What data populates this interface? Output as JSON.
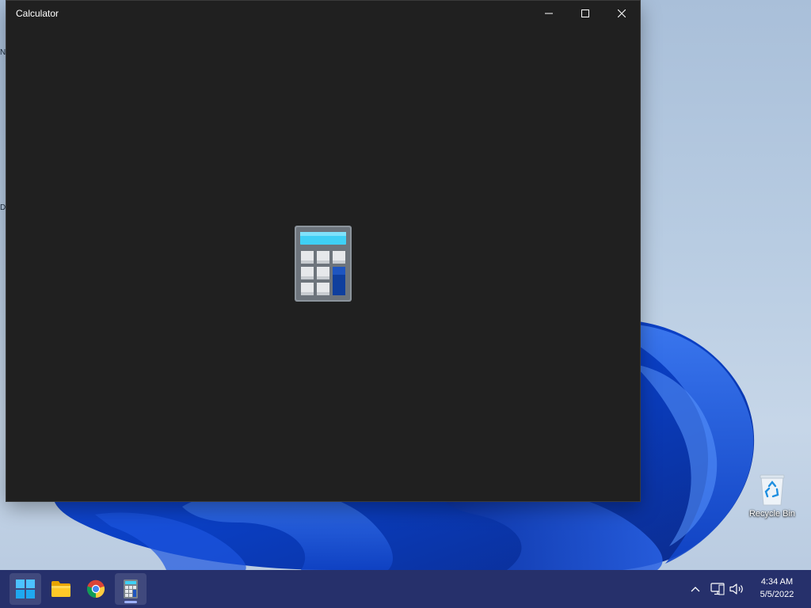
{
  "window": {
    "title": "Calculator",
    "app_icon": "calculator-splash-icon"
  },
  "caption_buttons": {
    "minimize": "minimize-icon",
    "maximize": "maximize-icon",
    "close": "close-icon"
  },
  "desktop": {
    "recycle_bin_label": "Recycle Bin",
    "edge_glyphs": [
      "N",
      "D"
    ]
  },
  "taskbar": {
    "apps": [
      {
        "name": "start",
        "icon": "windows-logo-icon"
      },
      {
        "name": "file-explorer",
        "icon": "folder-icon"
      },
      {
        "name": "chrome",
        "icon": "chrome-icon"
      },
      {
        "name": "calculator",
        "icon": "calculator-icon",
        "active": true
      }
    ],
    "tray": {
      "chevron": "chevron-up-icon",
      "network": "network-icon",
      "volume": "volume-icon"
    },
    "clock": {
      "time": "4:34 AM",
      "date": "5/5/2022"
    }
  },
  "colors": {
    "window_bg": "#202020",
    "taskbar_bg": "#26306b",
    "accent": "#3fd0f5"
  }
}
